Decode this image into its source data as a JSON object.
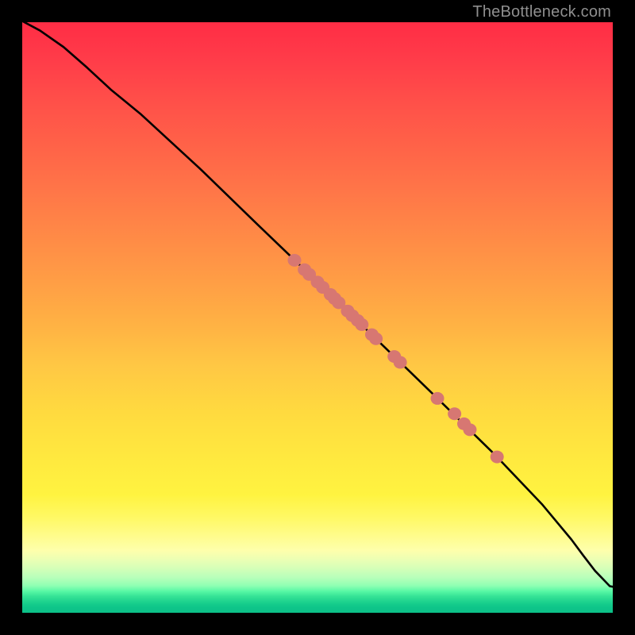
{
  "watermark": "TheBottleneck.com",
  "chart_data": {
    "type": "line",
    "title": "",
    "xlabel": "",
    "ylabel": "",
    "xlim": [
      0,
      100
    ],
    "ylim": [
      0,
      100
    ],
    "grid": false,
    "legend": false,
    "background": "rainbow-gradient-red-to-green",
    "series": [
      {
        "name": "curve",
        "x": [
          0,
          3,
          7,
          11,
          15,
          20,
          30,
          40,
          50,
          60,
          70,
          80,
          88,
          93,
          95,
          97,
          99.5,
          100
        ],
        "y": [
          100.2,
          98.6,
          95.8,
          92.3,
          88.6,
          84.5,
          75.3,
          65.6,
          56.0,
          46.3,
          36.6,
          26.8,
          18.4,
          12.4,
          9.7,
          7.1,
          4.5,
          4.4
        ]
      },
      {
        "name": "highlighted-points",
        "x": [
          46.1,
          47.8,
          48.6,
          50.0,
          50.9,
          52.2,
          52.9,
          53.6,
          55.1,
          55.9,
          56.8,
          57.5,
          59.2,
          59.9,
          63.0,
          64.0,
          70.3,
          73.2,
          74.8,
          75.8,
          80.4
        ],
        "y": [
          59.7,
          58.1,
          57.3,
          56.0,
          55.1,
          53.9,
          53.2,
          52.5,
          51.1,
          50.3,
          49.5,
          48.8,
          47.1,
          46.4,
          43.4,
          42.4,
          36.3,
          33.7,
          32.0,
          31.0,
          26.4
        ]
      }
    ]
  }
}
